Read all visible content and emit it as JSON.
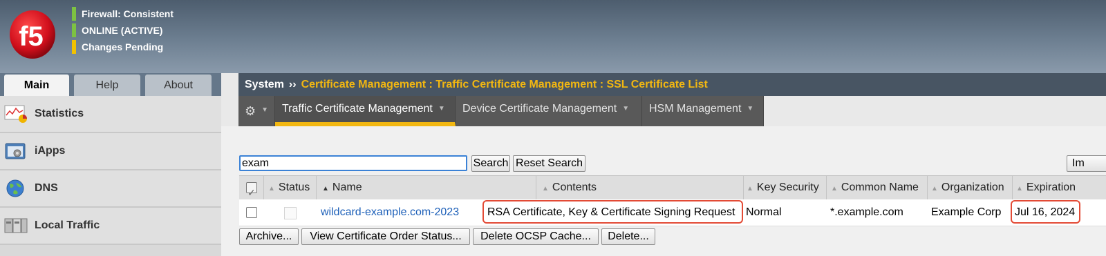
{
  "header": {
    "statuses": [
      {
        "text": "Firewall: Consistent",
        "color": "#7dc242"
      },
      {
        "text": "ONLINE (ACTIVE)",
        "color": "#7dc242"
      },
      {
        "text": "Changes Pending",
        "color": "#f2c200"
      }
    ],
    "logo_text": "f5"
  },
  "tabs": [
    {
      "label": "Main",
      "active": true
    },
    {
      "label": "Help",
      "active": false
    },
    {
      "label": "About",
      "active": false
    }
  ],
  "sidebar": {
    "items": [
      {
        "label": "Statistics",
        "icon": "statistics-icon"
      },
      {
        "label": "iApps",
        "icon": "iapps-icon"
      },
      {
        "label": "DNS",
        "icon": "dns-globe-icon"
      },
      {
        "label": "Local Traffic",
        "icon": "local-traffic-icon"
      }
    ]
  },
  "breadcrumb": {
    "system": "System",
    "separator": "››",
    "path": "Certificate Management : Traffic Certificate Management : SSL Certificate List"
  },
  "submenu": {
    "items": [
      {
        "label": "Traffic Certificate Management",
        "active": true
      },
      {
        "label": "Device Certificate Management",
        "active": false
      },
      {
        "label": "HSM Management",
        "active": false
      }
    ]
  },
  "search": {
    "value": "exam",
    "search_label": "Search",
    "reset_label": "Reset Search",
    "import_label": "Im"
  },
  "table": {
    "columns": [
      "Status",
      "Name",
      "Contents",
      "Key Security",
      "Common Name",
      "Organization",
      "Expiration"
    ],
    "rows": [
      {
        "name": "wildcard-example.com-2023",
        "contents": "RSA Certificate, Key & Certificate Signing Request",
        "key_security": "Normal",
        "common_name": "*.example.com",
        "organization": "Example Corp",
        "expiration": "Jul 16, 2024"
      }
    ]
  },
  "actions": {
    "archive": "Archive...",
    "view_order": "View Certificate Order Status...",
    "delete_ocsp": "Delete OCSP Cache...",
    "delete": "Delete..."
  },
  "colors": {
    "accent": "#f2b711",
    "highlight": "#e34a35",
    "link": "#1c5fb8"
  }
}
